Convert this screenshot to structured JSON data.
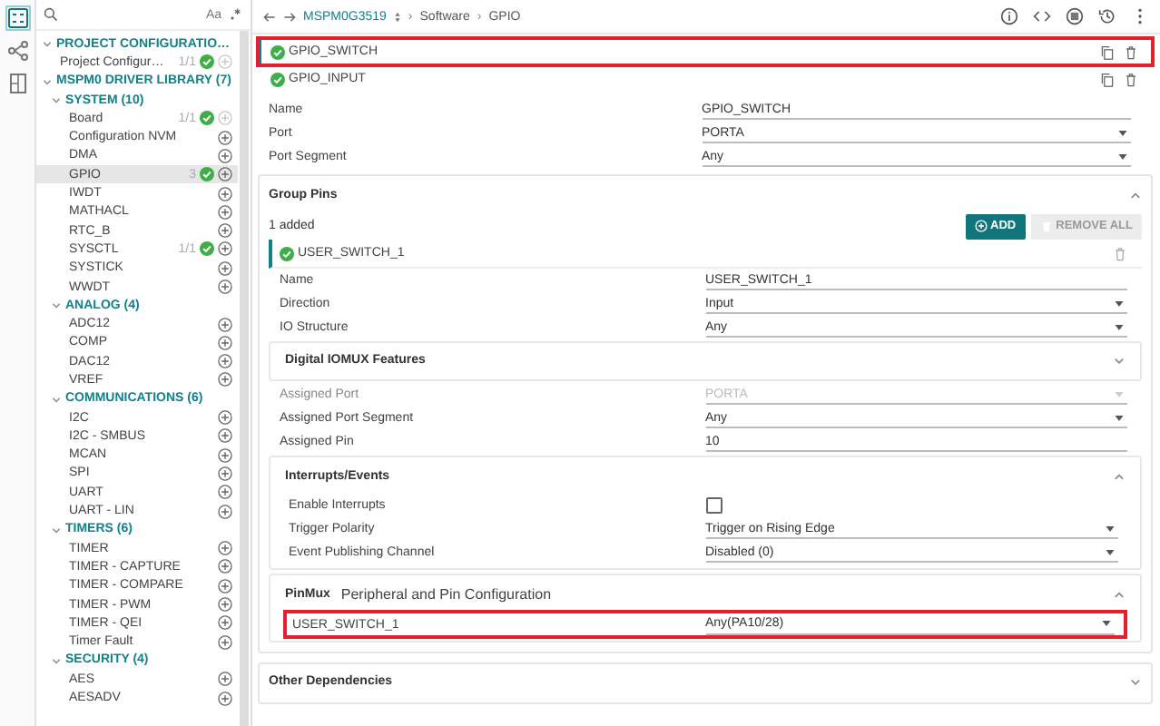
{
  "rail": [
    {
      "selected": true
    },
    {
      "selected": false
    },
    {
      "selected": false
    }
  ],
  "sidebar": {
    "case_toggle": "Aa",
    "tree": [
      {
        "label": "PROJECT CONFIGURATIO…",
        "expanded": true,
        "children": [
          {
            "label": "Project Configur…",
            "count": "1/1",
            "ok": true,
            "add_disabled": true,
            "selected": false
          }
        ]
      },
      {
        "label": "MSPM0 DRIVER LIBRARY (7)",
        "expanded": true,
        "children": [
          {
            "label": "SYSTEM (10)",
            "expanded": true,
            "children": [
              {
                "label": "Board",
                "count": "1/1",
                "ok": true,
                "add_disabled": true,
                "selected": false
              },
              {
                "label": "Configuration NVM",
                "ok": false,
                "add_disabled": false,
                "selected": false
              },
              {
                "label": "DMA",
                "ok": false,
                "add_disabled": false,
                "selected": false
              },
              {
                "label": "GPIO",
                "count": "3",
                "ok": true,
                "add_disabled": false,
                "selected": true
              },
              {
                "label": "IWDT",
                "ok": false,
                "add_disabled": false,
                "selected": false
              },
              {
                "label": "MATHACL",
                "ok": false,
                "add_disabled": false,
                "selected": false
              },
              {
                "label": "RTC_B",
                "ok": false,
                "add_disabled": false,
                "selected": false
              },
              {
                "label": "SYSCTL",
                "count": "1/1",
                "ok": true,
                "add_disabled": false,
                "selected": false
              },
              {
                "label": "SYSTICK",
                "ok": false,
                "add_disabled": false,
                "selected": false
              },
              {
                "label": "WWDT",
                "ok": false,
                "add_disabled": false,
                "selected": false
              }
            ]
          },
          {
            "label": "ANALOG (4)",
            "expanded": true,
            "children": [
              {
                "label": "ADC12",
                "ok": false,
                "add_disabled": false,
                "selected": false
              },
              {
                "label": "COMP",
                "ok": false,
                "add_disabled": false,
                "selected": false
              },
              {
                "label": "DAC12",
                "ok": false,
                "add_disabled": false,
                "selected": false
              },
              {
                "label": "VREF",
                "ok": false,
                "add_disabled": false,
                "selected": false
              }
            ]
          },
          {
            "label": "COMMUNICATIONS (6)",
            "expanded": true,
            "children": [
              {
                "label": "I2C",
                "ok": false,
                "add_disabled": false,
                "selected": false
              },
              {
                "label": "I2C - SMBUS",
                "ok": false,
                "add_disabled": false,
                "selected": false
              },
              {
                "label": "MCAN",
                "ok": false,
                "add_disabled": false,
                "selected": false
              },
              {
                "label": "SPI",
                "ok": false,
                "add_disabled": false,
                "selected": false
              },
              {
                "label": "UART",
                "ok": false,
                "add_disabled": false,
                "selected": false
              },
              {
                "label": "UART - LIN",
                "ok": false,
                "add_disabled": false,
                "selected": false
              }
            ]
          },
          {
            "label": "TIMERS (6)",
            "expanded": true,
            "children": [
              {
                "label": "TIMER",
                "ok": false,
                "add_disabled": false,
                "selected": false
              },
              {
                "label": "TIMER - CAPTURE",
                "ok": false,
                "add_disabled": false,
                "selected": false
              },
              {
                "label": "TIMER - COMPARE",
                "ok": false,
                "add_disabled": false,
                "selected": false
              },
              {
                "label": "TIMER - PWM",
                "ok": false,
                "add_disabled": false,
                "selected": false
              },
              {
                "label": "TIMER - QEI",
                "ok": false,
                "add_disabled": false,
                "selected": false
              },
              {
                "label": "Timer Fault",
                "ok": false,
                "add_disabled": false,
                "selected": false
              }
            ]
          },
          {
            "label": "SECURITY (4)",
            "expanded": true,
            "children": [
              {
                "label": "AES",
                "ok": false,
                "add_disabled": false,
                "selected": false
              },
              {
                "label": "AESADV",
                "ok": false,
                "add_disabled": false,
                "selected": false
              }
            ]
          }
        ]
      }
    ]
  },
  "breadcrumb": {
    "device": "MSPM0G3519",
    "path": [
      {
        "separator": "›",
        "label": "Software"
      },
      {
        "separator": "›",
        "label": "GPIO"
      }
    ]
  },
  "instances": [
    {
      "name": "GPIO_SWITCH",
      "ok": true,
      "selected": true,
      "highlighted": true
    },
    {
      "name": "GPIO_INPUT",
      "ok": true,
      "selected": false,
      "highlighted": false
    }
  ],
  "fields": [
    {
      "label": "Name",
      "kind": "text",
      "value": "GPIO_SWITCH",
      "disabled": false
    },
    {
      "label": "Port",
      "kind": "select",
      "value": "PORTA",
      "disabled": false
    },
    {
      "label": "Port Segment",
      "kind": "select",
      "value": "Any",
      "disabled": false
    }
  ],
  "group_pins": {
    "title": "Group Pins",
    "expanded": true,
    "summary": "1 added",
    "add_label": "ADD",
    "remove_label": "REMOVE ALL",
    "remove_disabled": true,
    "pin": {
      "name": "USER_SWITCH_1",
      "ok": true,
      "fields": [
        {
          "label": "Name",
          "kind": "text",
          "value": "USER_SWITCH_1",
          "disabled": false
        },
        {
          "label": "Direction",
          "kind": "select",
          "value": "Input",
          "disabled": false
        },
        {
          "label": "IO Structure",
          "kind": "select",
          "value": "Any",
          "disabled": false
        }
      ]
    },
    "iomux": {
      "title": "Digital IOMUX Features",
      "expanded": false,
      "fields": [
        {
          "label": "Assigned Port",
          "kind": "select",
          "value": "PORTA",
          "disabled": true
        },
        {
          "label": "Assigned Port Segment",
          "kind": "select",
          "value": "Any",
          "disabled": false
        },
        {
          "label": "Assigned Pin",
          "kind": "text",
          "value": "10",
          "disabled": false
        }
      ]
    },
    "interrupts": {
      "title": "Interrupts/Events",
      "expanded": true,
      "fields": [
        {
          "label": "Enable Interrupts",
          "kind": "checkbox",
          "checked": false,
          "disabled": false
        },
        {
          "label": "Trigger Polarity",
          "kind": "select",
          "value": "Trigger on Rising Edge",
          "disabled": false
        },
        {
          "label": "Event Publishing Channel",
          "kind": "select",
          "value": "Disabled (0)",
          "disabled": false
        }
      ]
    },
    "pinmux": {
      "title": "PinMux",
      "subtitle": "Peripheral and Pin Configuration",
      "expanded": true,
      "rows": [
        {
          "label": "USER_SWITCH_1",
          "value": "Any(PA10/28)",
          "highlighted": true
        }
      ]
    }
  },
  "other": {
    "title": "Other Dependencies",
    "expanded": false
  }
}
